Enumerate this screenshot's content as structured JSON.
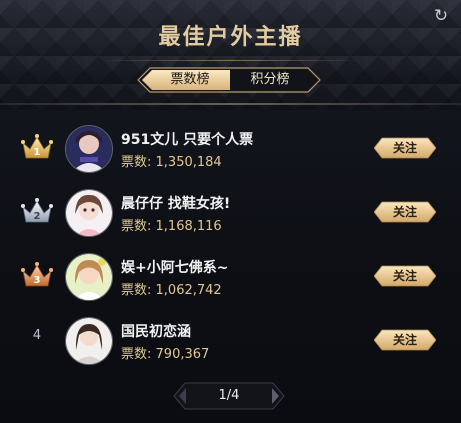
{
  "header": {
    "title": "最佳户外主播",
    "refresh_icon": "refresh-icon"
  },
  "tabs": [
    {
      "label": "票数榜",
      "active": true
    },
    {
      "label": "积分榜",
      "active": false
    }
  ],
  "entries": [
    {
      "rank": "1",
      "name": "951文儿 只要个人票",
      "votes_label": "票数:",
      "votes": "1,350,184",
      "follow": "关注",
      "badge": "gold-crown-icon"
    },
    {
      "rank": "2",
      "name": "晨仔仔 找鞋女孩!",
      "votes_label": "票数:",
      "votes": "1,168,116",
      "follow": "关注",
      "badge": "silver-crown-icon"
    },
    {
      "rank": "3",
      "name": "娱+小阿七佛系~",
      "votes_label": "票数:",
      "votes": "1,062,742",
      "follow": "关注",
      "badge": "bronze-crown-icon"
    },
    {
      "rank": "4",
      "name": "国民初恋涵",
      "votes_label": "票数:",
      "votes": "790,367",
      "follow": "关注",
      "badge": ""
    }
  ],
  "pager": {
    "text": "1/4"
  },
  "colors": {
    "gold": "#e1c793",
    "title": "#e3cda0",
    "button": "#e8c88e"
  }
}
